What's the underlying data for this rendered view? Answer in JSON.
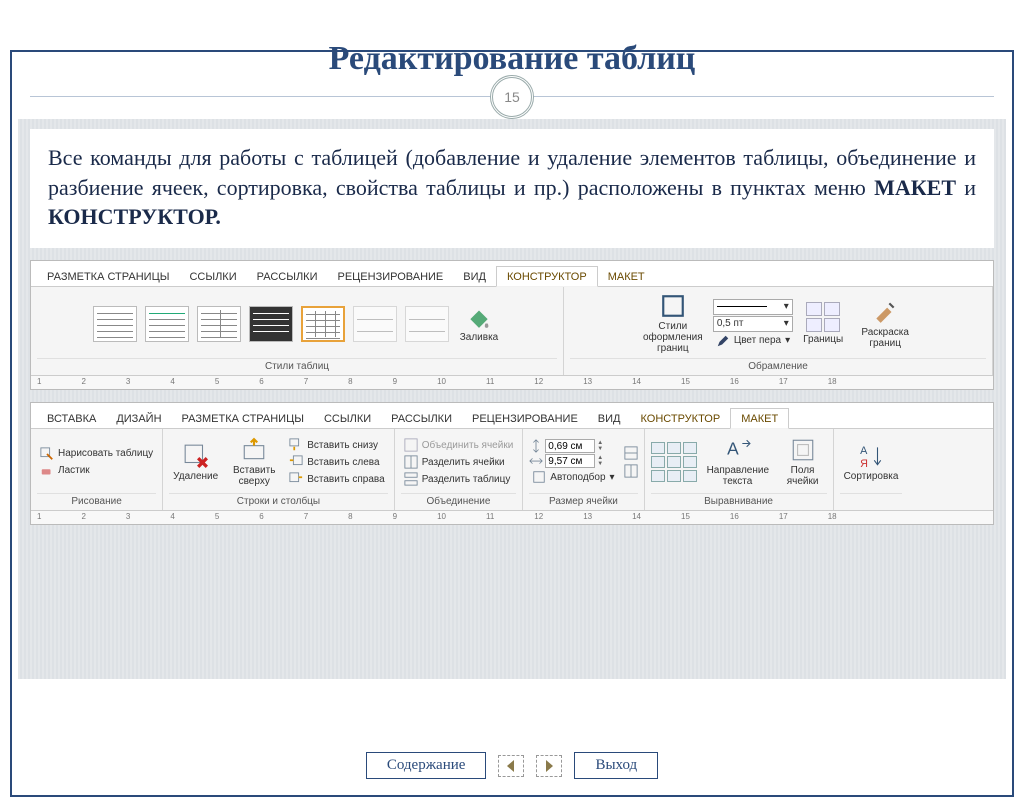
{
  "title": "Редактирование таблиц",
  "page_number": "15",
  "description": {
    "line1": "Все команды для работы с таблицей (добавление и удаление элементов таблицы, объединение и разбиение ячеек, сортировка, свойства таблицы и пр.) расположены в пунктах меню ",
    "bold1": "МАКЕТ",
    "and": " и ",
    "bold2": "КОНСТРУКТОР."
  },
  "ribbon1": {
    "tabs": [
      "РАЗМЕТКА СТРАНИЦЫ",
      "ССЫЛКИ",
      "РАССЫЛКИ",
      "РЕЦЕНЗИРОВАНИЕ",
      "ВИД",
      "КОНСТРУКТОР",
      "МАКЕТ"
    ],
    "active_tab": "КОНСТРУКТОР",
    "groups": {
      "styles_label": "Стили таблиц",
      "fill": "Заливка",
      "border_styles": "Стили оформления границ",
      "pt_value": "0,5 пт",
      "pen_color": "Цвет пера",
      "borders": "Границы",
      "painter": "Раскраска границ",
      "framing_label": "Обрамление"
    },
    "ruler_marks": [
      "1",
      "2",
      "3",
      "4",
      "5",
      "6",
      "7",
      "8",
      "9",
      "10",
      "11",
      "12",
      "13",
      "14",
      "15",
      "16",
      "17",
      "18"
    ]
  },
  "ribbon2": {
    "tabs": [
      "ВСТАВКА",
      "ДИЗАЙН",
      "РАЗМЕТКА СТРАНИЦЫ",
      "ССЫЛКИ",
      "РАССЫЛКИ",
      "РЕЦЕНЗИРОВАНИЕ",
      "ВИД",
      "КОНСТРУКТОР",
      "МАКЕТ"
    ],
    "active_tab": "МАКЕТ",
    "drawing": {
      "draw_table": "Нарисовать таблицу",
      "eraser": "Ластик",
      "label": "Рисование"
    },
    "rows_cols": {
      "delete": "Удаление",
      "insert_above": "Вставить сверху",
      "insert_below": "Вставить снизу",
      "insert_left": "Вставить слева",
      "insert_right": "Вставить справа",
      "label": "Строки и столбцы"
    },
    "merge": {
      "merge_cells": "Объединить ячейки",
      "split_cells": "Разделить ячейки",
      "split_table": "Разделить таблицу",
      "label": "Объединение"
    },
    "cell_size": {
      "height": "0,69 см",
      "width": "9,57 см",
      "autofit": "Автоподбор",
      "label": "Размер ячейки"
    },
    "alignment": {
      "text_direction": "Направление текста",
      "margins": "Поля ячейки",
      "label": "Выравнивание"
    },
    "sort": "Сортировка"
  },
  "nav": {
    "contents": "Содержание",
    "exit": "Выход"
  }
}
